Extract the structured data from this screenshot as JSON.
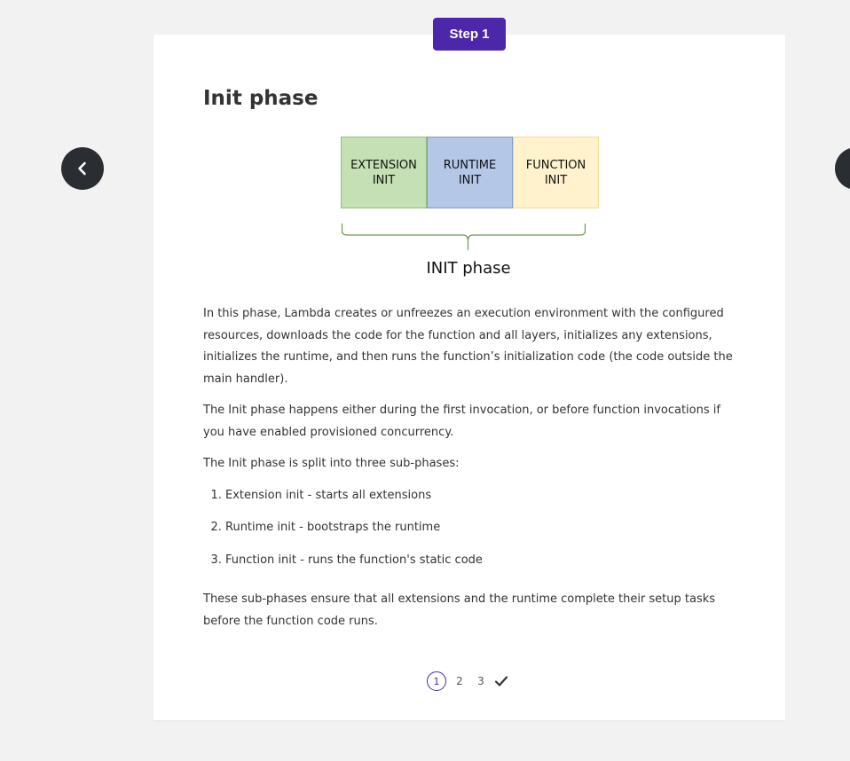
{
  "badge": {
    "label": "Step 1"
  },
  "title": "Init phase",
  "diagram": {
    "boxes": [
      {
        "line1": "EXTENSION",
        "line2": "INIT",
        "color": "#c4e0b4"
      },
      {
        "line1": "RUNTIME",
        "line2": "INIT",
        "color": "#b4c7e7"
      },
      {
        "line1": "FUNCTION",
        "line2": "INIT",
        "color": "#fff2cc"
      }
    ],
    "brace_label": "INIT phase"
  },
  "paragraphs": [
    "In this phase, Lambda creates or unfreezes an execution environment with the configured resources, downloads the code for the function and all layers, initializes any extensions, initializes the runtime, and then runs the function’s initialization code (the code outside the main handler).",
    "The Init phase happens either during the first invocation, or before function invocations if you have enabled provisioned concurrency.",
    "The Init phase is split into three sub-phases:"
  ],
  "list_items": [
    "Extension init - starts all extensions",
    "Runtime init - bootstraps the runtime",
    "Function init - runs the function's static code"
  ],
  "closing": "These sub-phases ensure that all extensions and the runtime complete their setup tasks before the function code runs.",
  "pager": {
    "pages": [
      "1",
      "2",
      "3"
    ],
    "current": "1",
    "final_icon": "check-icon"
  },
  "nav": {
    "prev_icon": "chevron-left-icon",
    "next_icon": "chevron-right-icon"
  },
  "colors": {
    "accent": "#4d27aa",
    "nav_button": "#2a2e33"
  }
}
